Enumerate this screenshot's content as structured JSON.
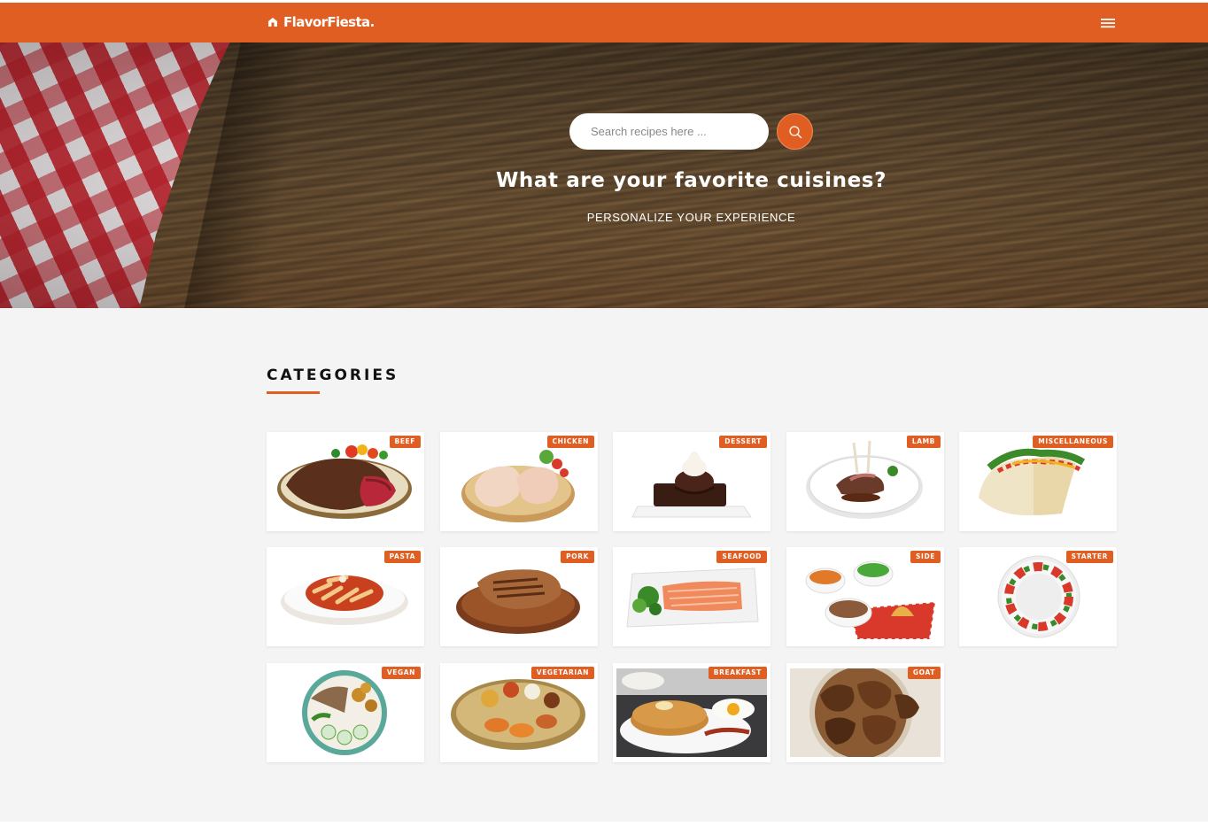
{
  "brand": {
    "name": "FlavorFiesta.",
    "icon": "home-icon"
  },
  "nav": {
    "menu_icon": "hamburger-menu-icon"
  },
  "hero": {
    "search_placeholder": "Search recipes here ...",
    "search_icon": "search-icon",
    "title": "What are your favorite cuisines?",
    "subtitle": "PERSONALIZE YOUR EXPERIENCE"
  },
  "categories": {
    "heading": "CATEGORIES",
    "items": [
      {
        "label": "BEEF"
      },
      {
        "label": "CHICKEN"
      },
      {
        "label": "DESSERT"
      },
      {
        "label": "LAMB"
      },
      {
        "label": "MISCELLANEOUS"
      },
      {
        "label": "PASTA"
      },
      {
        "label": "PORK"
      },
      {
        "label": "SEAFOOD"
      },
      {
        "label": "SIDE"
      },
      {
        "label": "STARTER"
      },
      {
        "label": "VEGAN"
      },
      {
        "label": "VEGETARIAN"
      },
      {
        "label": "BREAKFAST"
      },
      {
        "label": "GOAT"
      }
    ]
  },
  "colors": {
    "accent": "#e05e22",
    "page_bg": "#f4f4f4",
    "card_bg": "#ffffff"
  }
}
